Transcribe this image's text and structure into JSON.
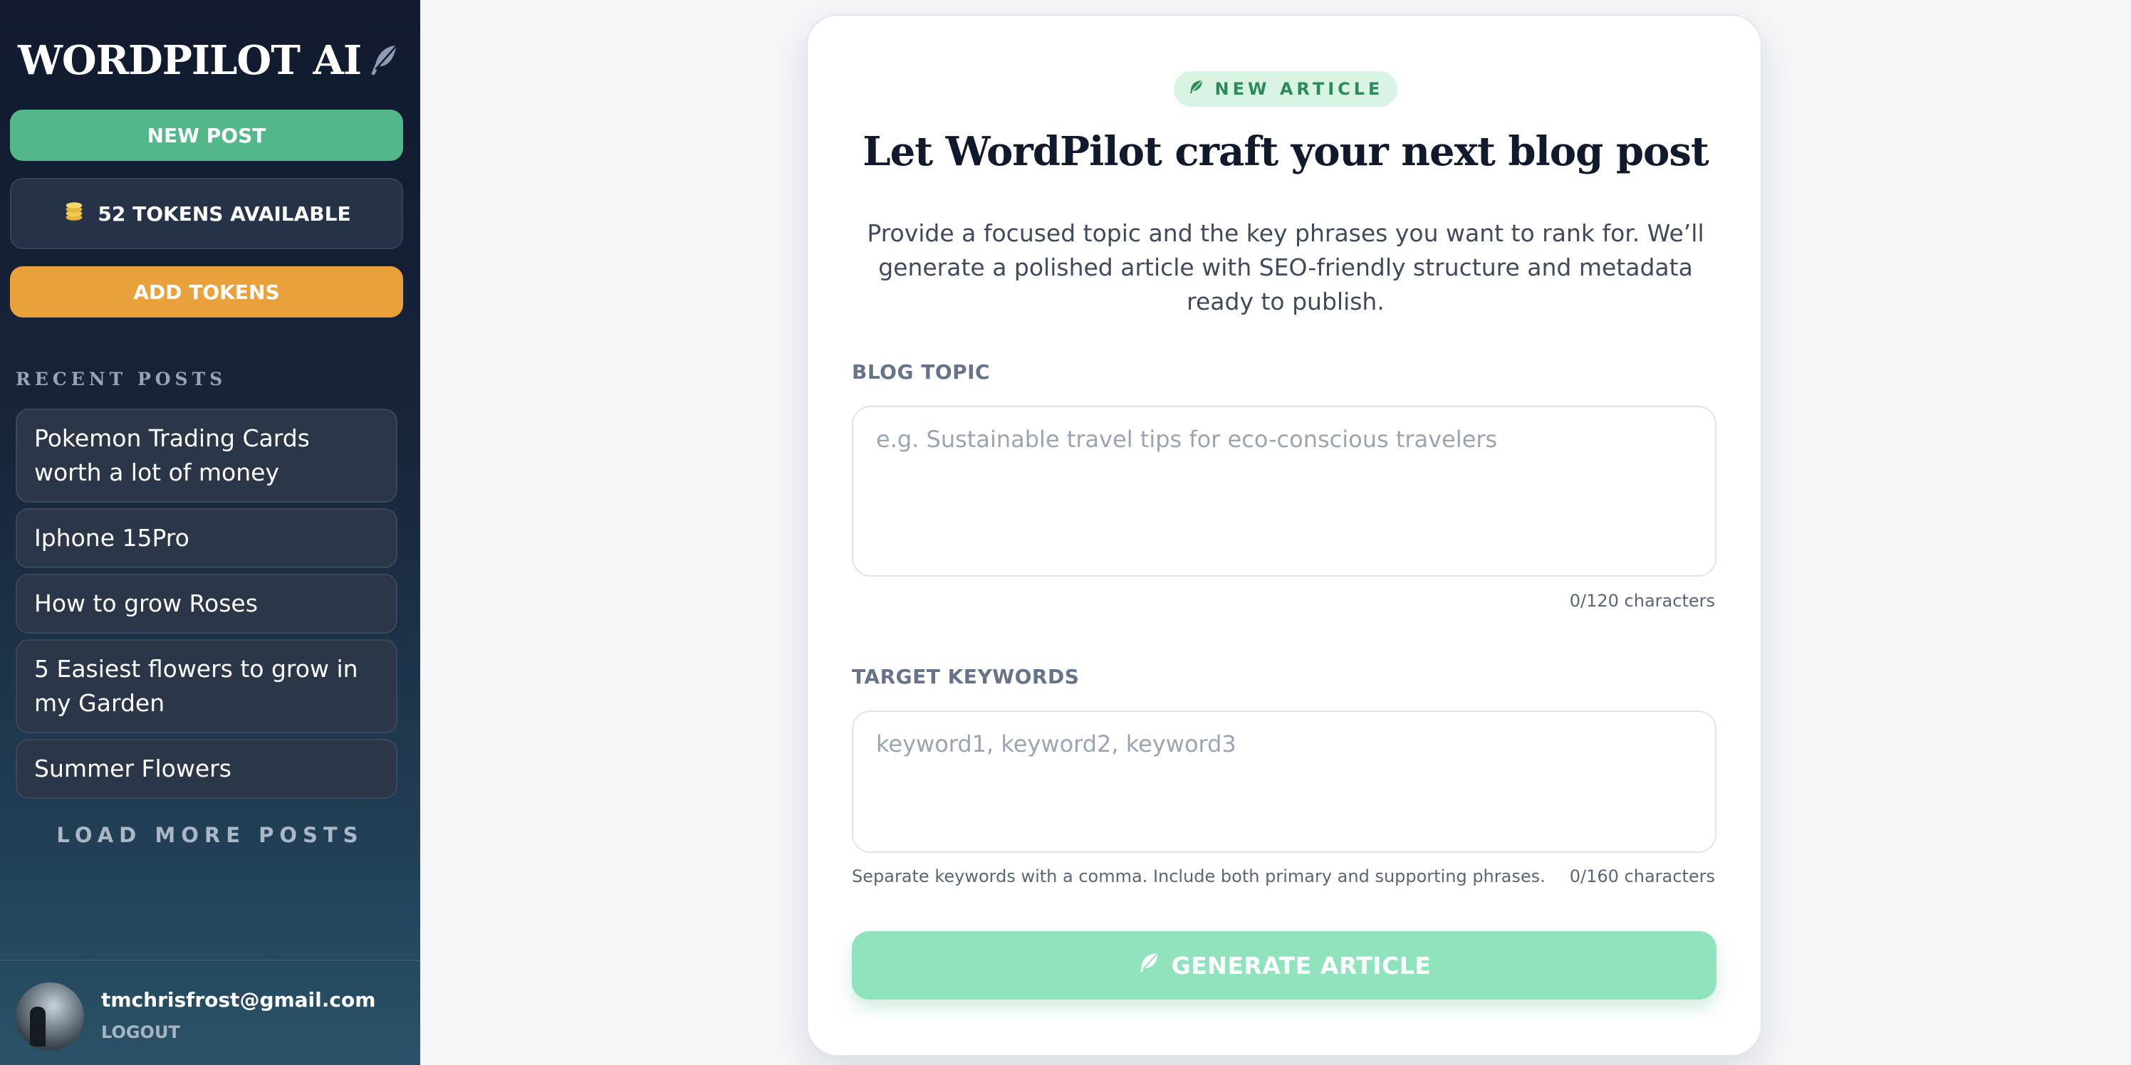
{
  "sidebar": {
    "logo": "WORDPILOT AI",
    "new_post": "NEW POST",
    "tokens": "52 TOKENS AVAILABLE",
    "add_tokens": "ADD TOKENS",
    "recent_title": "RECENT POSTS",
    "recent_posts": [
      "Pokemon Trading Cards worth a lot of money",
      "Iphone 15Pro",
      "How to grow Roses",
      "5 Easiest flowers to grow in my Garden",
      "Summer Flowers"
    ],
    "load_more": "LOAD MORE POSTS",
    "user_email": "tmchrisfrost@gmail.com",
    "logout": "LOGOUT"
  },
  "main": {
    "badge": "NEW ARTICLE",
    "headline": "Let WordPilot craft your next blog post",
    "description": "Provide a focused topic and the key phrases you want to rank for. We’ll generate a polished article with SEO-friendly structure and metadata ready to publish.",
    "topic_label": "BLOG TOPIC",
    "topic_placeholder": "e.g. Sustainable travel tips for eco-conscious travelers",
    "topic_value": "",
    "topic_count": "0/120 characters",
    "keywords_label": "TARGET KEYWORDS",
    "keywords_placeholder": "keyword1, keyword2, keyword3",
    "keywords_value": "",
    "keywords_hint": "Separate keywords with a comma. Include both primary and supporting phrases.",
    "keywords_count": "0/160 characters",
    "generate": "GENERATE ARTICLE"
  },
  "colors": {
    "accent_green": "#52b789",
    "accent_orange": "#e9a23b",
    "generate_disabled": "#8fe3bd"
  },
  "icons": [
    "feather-icon",
    "coins-icon",
    "leaf-icon"
  ]
}
